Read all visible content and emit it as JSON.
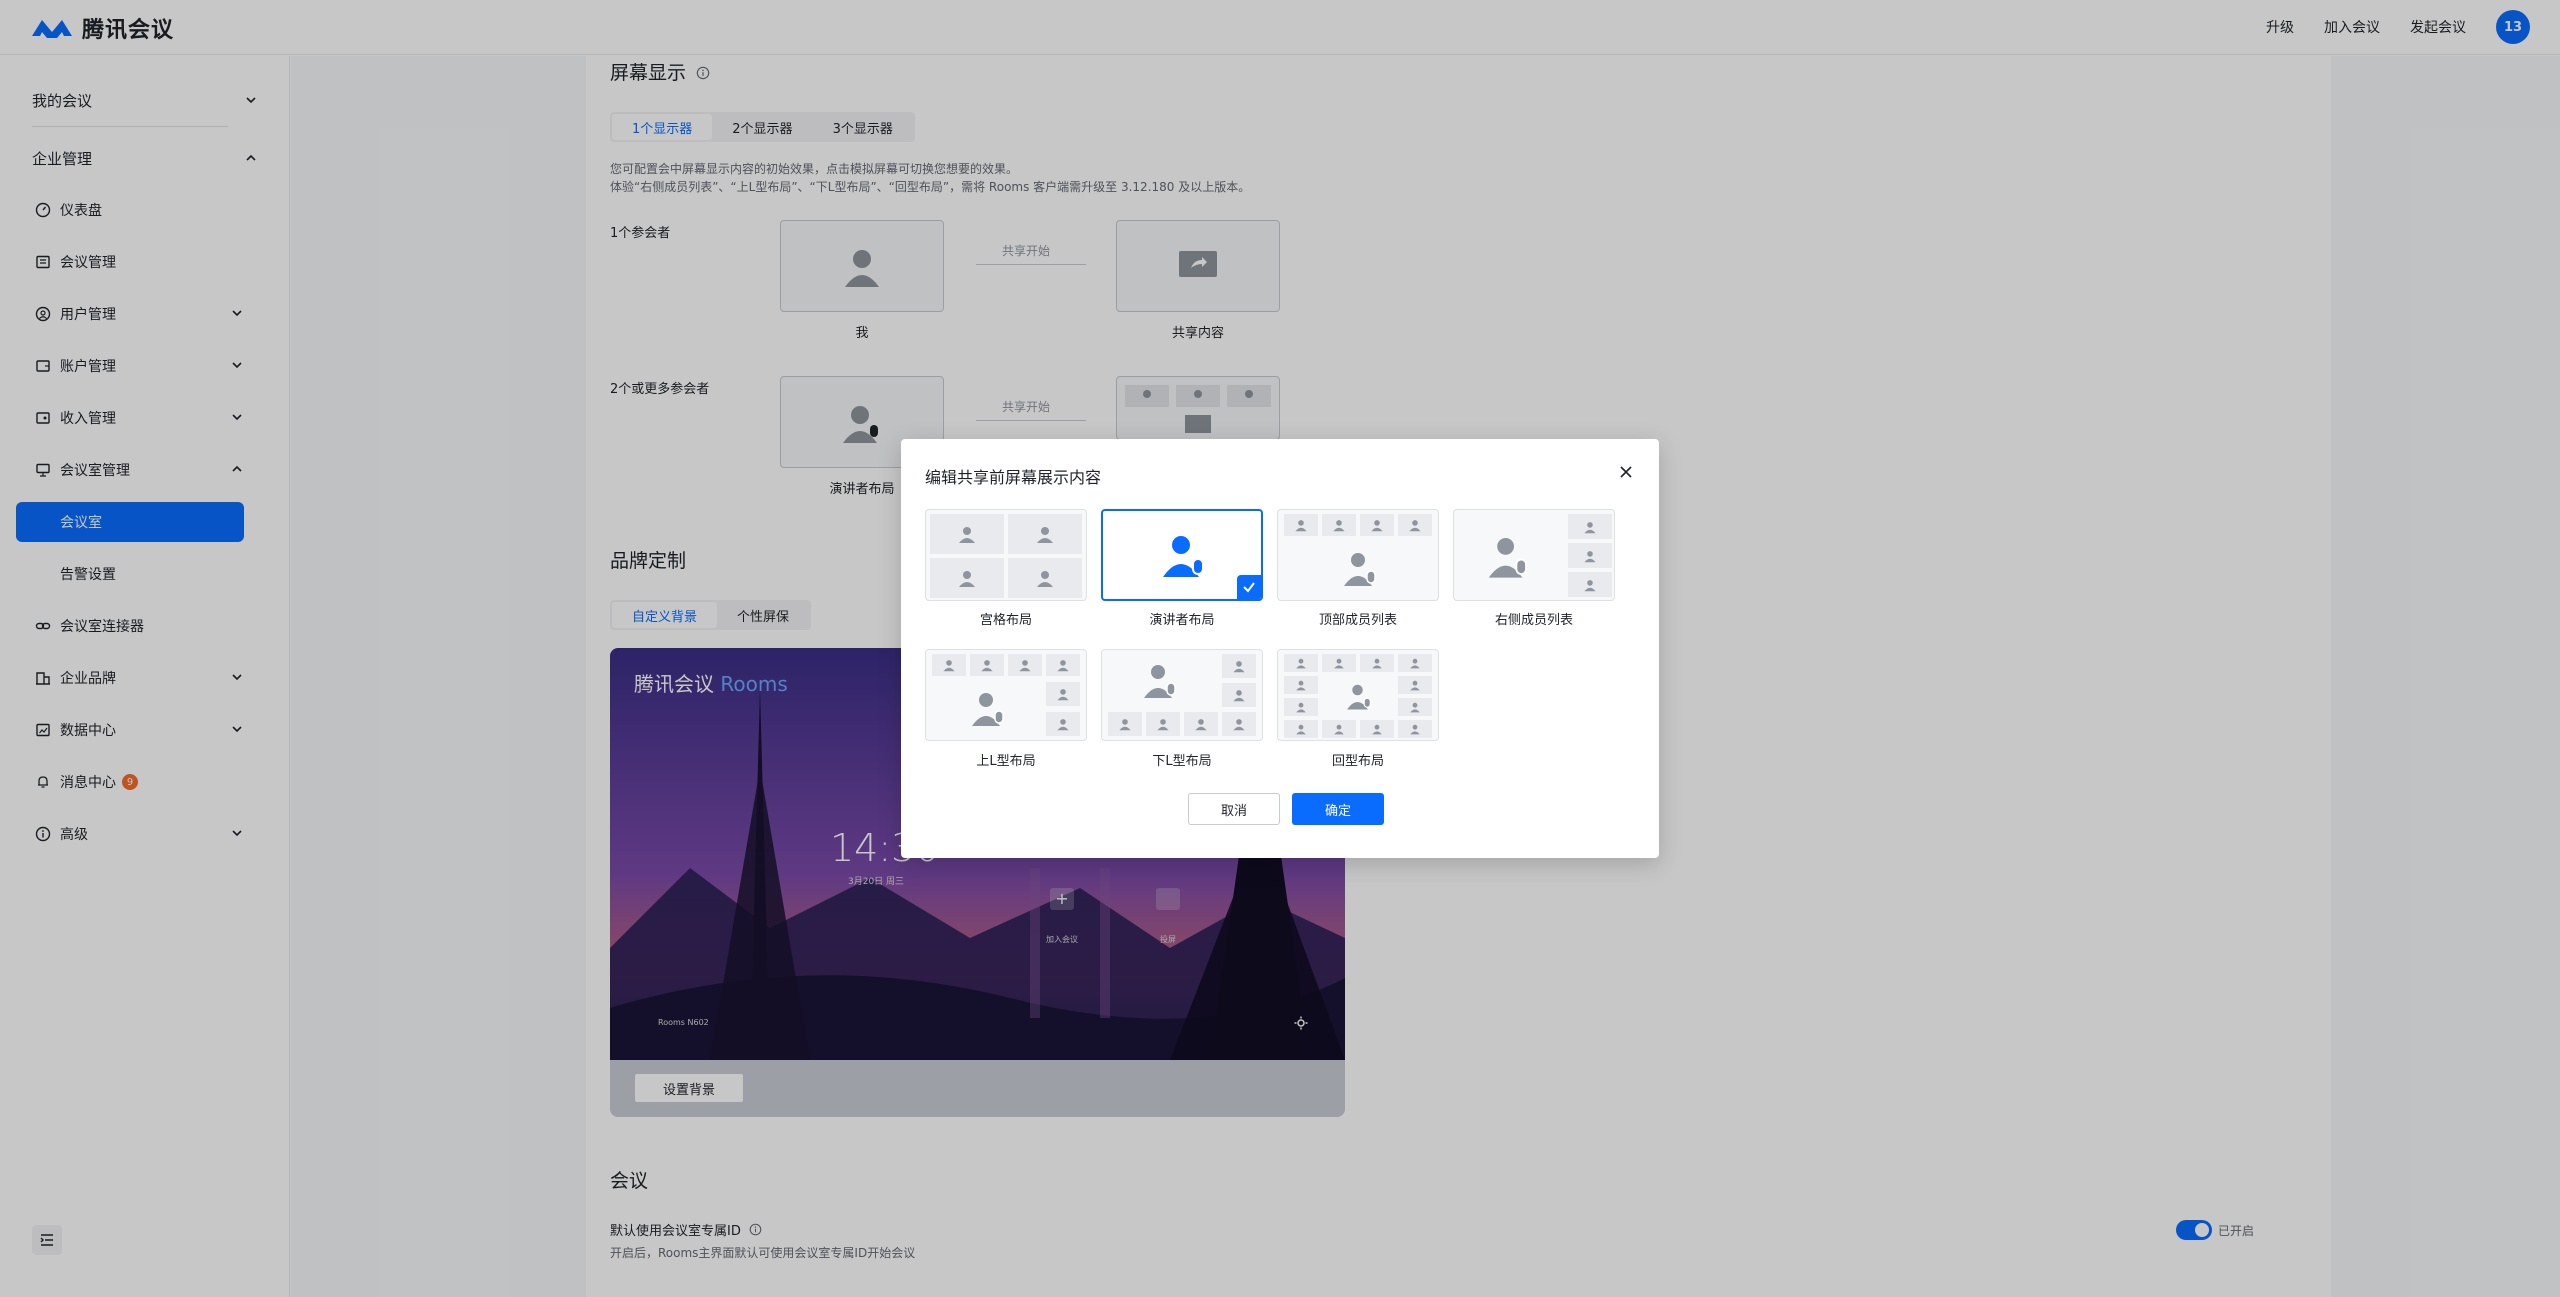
{
  "topbar": {
    "brand": "腾讯会议",
    "actions": [
      "升级",
      "加入会议",
      "发起会议"
    ],
    "avatar_text": "13"
  },
  "sidebar": {
    "my_meetings": "我的会议",
    "enterprise": "企业管理",
    "items": [
      {
        "label": "仪表盘",
        "icon": "dashboard-icon"
      },
      {
        "label": "会议管理",
        "icon": "list-icon"
      },
      {
        "label": "用户管理",
        "icon": "user-icon"
      },
      {
        "label": "账户管理",
        "icon": "wallet-icon"
      },
      {
        "label": "收入管理",
        "icon": "income-icon"
      },
      {
        "label": "会议室管理",
        "icon": "room-icon"
      }
    ],
    "sub_items": [
      "会议室",
      "告警设置"
    ],
    "items2": [
      {
        "label": "会议室连接器",
        "icon": "link-icon"
      },
      {
        "label": "企业品牌",
        "icon": "brand-icon"
      },
      {
        "label": "数据中心",
        "icon": "chart-icon"
      },
      {
        "label": "消息中心",
        "icon": "bell-icon",
        "badge": "9"
      },
      {
        "label": "高级",
        "icon": "info-icon"
      }
    ]
  },
  "screen": {
    "title": "屏幕显示",
    "tabs": [
      "1个显示器",
      "2个显示器",
      "3个显示器"
    ],
    "hint1": "您可配置会中屏幕显示内容的初始效果，点击模拟屏幕可切换您想要的效果。",
    "hint2": "体验“右侧成员列表”、“上L型布局”、“下L型布局”、“回型布局”，需将 Rooms 客户端需升级至 3.12.180 及以上版本。",
    "row1_label": "1个参会者",
    "row1_cap_left": "我",
    "row1_cap_right": "共享内容",
    "arrow_label": "共享开始",
    "row2_label": "2个或更多参会者",
    "row2_cap_left": "演讲者布局"
  },
  "brand": {
    "title": "品牌定制",
    "tabs": [
      "自定义背景",
      "个性屏保"
    ],
    "preview_brand": "腾讯会议",
    "preview_rooms": "Rooms",
    "preview_time": "14:30",
    "preview_date": "3月20日 周三",
    "preview_join": "加入会议",
    "preview_share": "投屏",
    "preview_room_name": "Rooms N602",
    "set_bg_button": "设置背景"
  },
  "meeting": {
    "title": "会议",
    "default_id_label": "默认使用会议室专属ID",
    "default_id_desc": "开启后，Rooms主界面默认可使用会议室专属ID开始会议",
    "toggle_state": "已开启"
  },
  "modal": {
    "title": "编辑共享前屏幕展示内容",
    "options": [
      "宫格布局",
      "演讲者布局",
      "顶部成员列表",
      "右侧成员列表",
      "上L型布局",
      "下L型布局",
      "回型布局"
    ],
    "selected": "演讲者布局",
    "cancel": "取消",
    "confirm": "确定"
  },
  "colors": {
    "accent": "#0a6cff",
    "badge": "#f56c2d"
  }
}
